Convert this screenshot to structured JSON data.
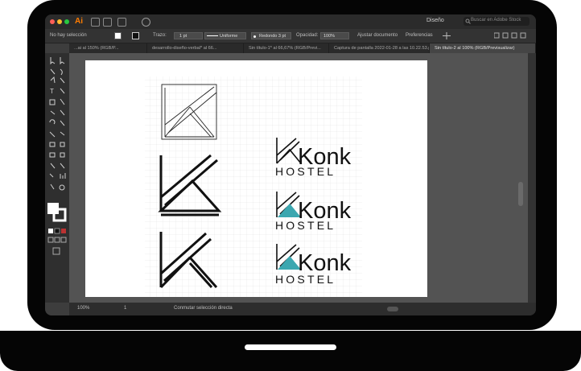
{
  "app": {
    "logo": "Ai",
    "workspace": "Diseño",
    "search_placeholder": "Buscar en Adobe Stock"
  },
  "control_bar": {
    "selection": "No hay selección",
    "stroke_label": "Trazo:",
    "stroke_value": "1 pt",
    "profile": "Uniforme",
    "brush": "Redondo 3 pt",
    "opacity_label": "Opacidad:",
    "opacity_value": "100%",
    "document_button": "Ajustar documento",
    "preferences_button": "Preferencias"
  },
  "tabs": [
    {
      "label": "...ai al 150% (RGB/P..."
    },
    {
      "label": "desarrollo-diseño-verbal* al 66..."
    },
    {
      "label": "Sin título-1* al 66,67% (RGB/Previ..."
    },
    {
      "label": "Captura de pantalla 2022-01-28 a las 10.22.53.png"
    },
    {
      "label": "Sin título-2 al 100% (RGB/Previsualizar)"
    }
  ],
  "logo_text": {
    "brand": "Konk",
    "subtitle": "HOSTEL"
  },
  "status_bar": {
    "zoom": "100%",
    "page": "1",
    "mode": "Conmutar selección directa"
  },
  "colors": {
    "accent": "#3ba7b0",
    "logo_orange": "#ff7c00"
  },
  "icons": [
    "close-dot",
    "minimize-dot",
    "maximize-dot",
    "home-icon",
    "search-icon",
    "selection-tool-icon"
  ]
}
